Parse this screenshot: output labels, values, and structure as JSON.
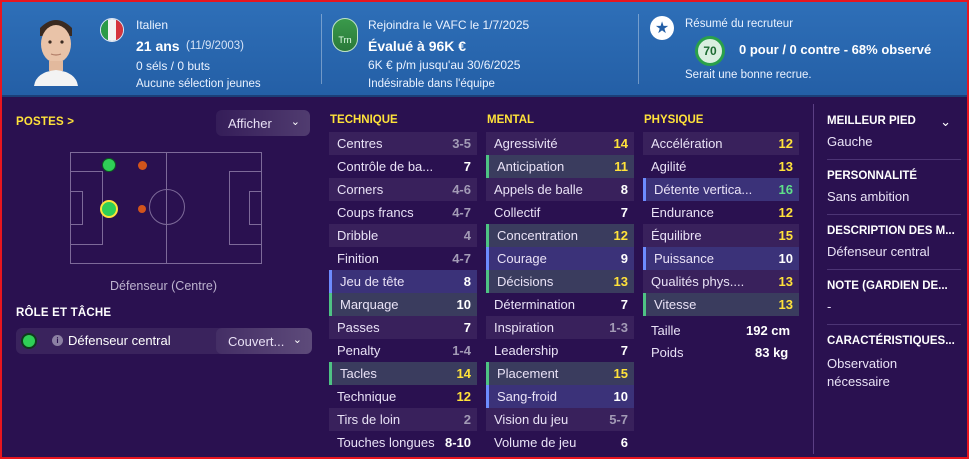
{
  "header": {
    "nationality": "Italien",
    "age": "21 ans",
    "dob": "(11/9/2003)",
    "caps": "0 séls / 0 buts",
    "youth": "Aucune sélection jeunes",
    "club_badge": "Trn",
    "join": "Rejoindra le VAFC le 1/7/2025",
    "value": "Évalué à 96K €",
    "wage": "6K € p/m jusqu'au 30/6/2025",
    "status": "Indésirable dans l'équipe",
    "scout_title": "Résumé du recruteur",
    "scout_rating": "70",
    "scout_summary": "0 pour / 0 contre - 68% observé",
    "scout_note": "Serait une bonne recrue."
  },
  "left": {
    "positions_title": "POSTES >",
    "show_label": "Afficher",
    "position_caption": "Défenseur (Centre)",
    "role_title": "RÔLE ET TÂCHE",
    "role_info": "i",
    "role_name": "Défenseur central",
    "duty": "Couvert..."
  },
  "technique": {
    "title": "TECHNIQUE",
    "rows": [
      {
        "name": "Centres",
        "value": "3-5",
        "tone": "grey"
      },
      {
        "name": "Contrôle de ba...",
        "value": "7",
        "tone": "white"
      },
      {
        "name": "Corners",
        "value": "4-6",
        "tone": "grey"
      },
      {
        "name": "Coups francs",
        "value": "4-7",
        "tone": "grey"
      },
      {
        "name": "Dribble",
        "value": "4",
        "tone": "grey"
      },
      {
        "name": "Finition",
        "value": "4-7",
        "tone": "grey"
      },
      {
        "name": "Jeu de tête",
        "value": "8",
        "tone": "white"
      },
      {
        "name": "Marquage",
        "value": "10",
        "tone": "white"
      },
      {
        "name": "Passes",
        "value": "7",
        "tone": "white"
      },
      {
        "name": "Penalty",
        "value": "1-4",
        "tone": "grey"
      },
      {
        "name": "Tacles",
        "value": "14",
        "tone": "yellow"
      },
      {
        "name": "Technique",
        "value": "12",
        "tone": "yellow"
      },
      {
        "name": "Tirs de loin",
        "value": "2",
        "tone": "grey"
      },
      {
        "name": "Touches longues",
        "value": "8-10",
        "tone": "white"
      }
    ]
  },
  "mental": {
    "title": "MENTAL",
    "rows": [
      {
        "name": "Agressivité",
        "value": "14",
        "tone": "yellow"
      },
      {
        "name": "Anticipation",
        "value": "11",
        "tone": "yellow"
      },
      {
        "name": "Appels de balle",
        "value": "8",
        "tone": "white"
      },
      {
        "name": "Collectif",
        "value": "7",
        "tone": "white"
      },
      {
        "name": "Concentration",
        "value": "12",
        "tone": "yellow"
      },
      {
        "name": "Courage",
        "value": "9",
        "tone": "white"
      },
      {
        "name": "Décisions",
        "value": "13",
        "tone": "yellow"
      },
      {
        "name": "Détermination",
        "value": "7",
        "tone": "white"
      },
      {
        "name": "Inspiration",
        "value": "1-3",
        "tone": "grey"
      },
      {
        "name": "Leadership",
        "value": "7",
        "tone": "white"
      },
      {
        "name": "Placement",
        "value": "15",
        "tone": "yellow"
      },
      {
        "name": "Sang-froid",
        "value": "10",
        "tone": "white"
      },
      {
        "name": "Vision du jeu",
        "value": "5-7",
        "tone": "grey"
      },
      {
        "name": "Volume de jeu",
        "value": "6",
        "tone": "white"
      }
    ]
  },
  "physique": {
    "title": "PHYSIQUE",
    "rows": [
      {
        "name": "Accélération",
        "value": "12",
        "tone": "yellow"
      },
      {
        "name": "Agilité",
        "value": "13",
        "tone": "yellow"
      },
      {
        "name": "Détente vertica...",
        "value": "16",
        "tone": "green"
      },
      {
        "name": "Endurance",
        "value": "12",
        "tone": "yellow"
      },
      {
        "name": "Équilibre",
        "value": "15",
        "tone": "yellow"
      },
      {
        "name": "Puissance",
        "value": "10",
        "tone": "white"
      },
      {
        "name": "Qualités phys....",
        "value": "13",
        "tone": "yellow"
      },
      {
        "name": "Vitesse",
        "value": "13",
        "tone": "yellow"
      }
    ],
    "height_label": "Taille",
    "height_value": "192 cm",
    "weight_label": "Poids",
    "weight_value": "83 kg"
  },
  "right": {
    "foot_title": "MEILLEUR PIED",
    "foot_value": "Gauche",
    "personality_title": "PERSONNALITÉ",
    "personality_value": "Sans ambition",
    "desc_title": "DESCRIPTION DES M...",
    "desc_value": "Défenseur central",
    "note_title": "NOTE (GARDIEN DE...",
    "note_value": "-",
    "traits_title": "CARACTÉRISTIQUES...",
    "traits_value": "Observation nécessaire"
  },
  "colors": {
    "header_blue": "#2e6fb8",
    "background": "#2a1150",
    "accent_yellow": "#ffe23a",
    "good_green": "#5ee08a",
    "frame_red": "#e8161f"
  }
}
